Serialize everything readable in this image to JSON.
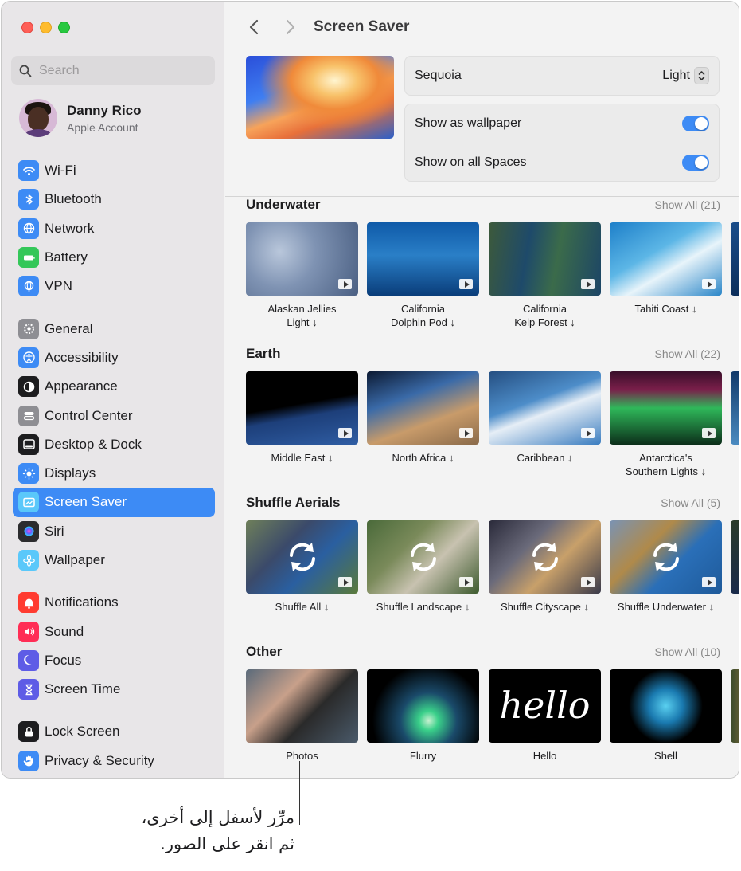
{
  "sidebar": {
    "search_placeholder": "Search",
    "account": {
      "name": "Danny Rico",
      "subtitle": "Apple Account"
    },
    "groups": [
      [
        {
          "label": "Wi-Fi",
          "icon": "wifi-icon",
          "color": "#3d8bf5"
        },
        {
          "label": "Bluetooth",
          "icon": "bluetooth-icon",
          "color": "#3d8bf5"
        },
        {
          "label": "Network",
          "icon": "globe-icon",
          "color": "#3d8bf5"
        },
        {
          "label": "Battery",
          "icon": "battery-icon",
          "color": "#34c759"
        },
        {
          "label": "VPN",
          "icon": "vpn-globe-icon",
          "color": "#3d8bf5"
        }
      ],
      [
        {
          "label": "General",
          "icon": "gear-icon",
          "color": "#8e8e93"
        },
        {
          "label": "Accessibility",
          "icon": "accessibility-icon",
          "color": "#3d8bf5"
        },
        {
          "label": "Appearance",
          "icon": "appearance-icon",
          "color": "#1d1d1f"
        },
        {
          "label": "Control Center",
          "icon": "control-center-icon",
          "color": "#8e8e93"
        },
        {
          "label": "Desktop & Dock",
          "icon": "dock-icon",
          "color": "#1d1d1f"
        },
        {
          "label": "Displays",
          "icon": "sun-icon",
          "color": "#3d8bf5"
        },
        {
          "label": "Screen Saver",
          "icon": "screen-saver-icon",
          "color": "#5ac8fa",
          "active": true
        },
        {
          "label": "Siri",
          "icon": "siri-icon",
          "color": "#2c2c2e"
        },
        {
          "label": "Wallpaper",
          "icon": "flower-icon",
          "color": "#5ac8fa"
        }
      ],
      [
        {
          "label": "Notifications",
          "icon": "bell-icon",
          "color": "#ff3b30"
        },
        {
          "label": "Sound",
          "icon": "speaker-icon",
          "color": "#ff2d55"
        },
        {
          "label": "Focus",
          "icon": "moon-icon",
          "color": "#5e5ce6"
        },
        {
          "label": "Screen Time",
          "icon": "hourglass-icon",
          "color": "#5e5ce6"
        }
      ],
      [
        {
          "label": "Lock Screen",
          "icon": "lock-icon",
          "color": "#1d1d1f"
        },
        {
          "label": "Privacy & Security",
          "icon": "hand-icon",
          "color": "#3d8bf5"
        }
      ]
    ]
  },
  "toolbar": {
    "title": "Screen Saver"
  },
  "current": {
    "name": "Sequoia",
    "variant": "Light",
    "show_as_wallpaper": {
      "label": "Show as wallpaper",
      "on": true
    },
    "show_on_all_spaces": {
      "label": "Show on all Spaces",
      "on": true
    }
  },
  "sections": [
    {
      "title": "Underwater",
      "show_all": "Show All (21)",
      "tiles": [
        {
          "label": "Alaskan Jellies\nLight ↓",
          "bg": "radial-gradient(circle at 30% 40%, #b9c7db 0%, #7f93b3 40%, #4a5f82 100%)",
          "type": "video"
        },
        {
          "label": "California\nDolphin Pod ↓",
          "bg": "linear-gradient(180deg, #0f5aa8 0%, #2a7fc7 45%, #0a3d7a 100%)",
          "type": "video"
        },
        {
          "label": "California\nKelp Forest ↓",
          "bg": "linear-gradient(100deg, #3d5a3a 0%, #1e4a6a 35%, #3b6b4a 60%, #1c4566 100%)",
          "type": "video"
        },
        {
          "label": "Tahiti Coast ↓",
          "bg": "linear-gradient(150deg, #1d7fc9 0%, #5cb6e6 40%, #e8f4fa 60%, #2b86c8 100%)",
          "type": "video"
        }
      ],
      "peek": "linear-gradient(180deg, #1a4d8a, #0d2f5c)"
    },
    {
      "title": "Earth",
      "show_all": "Show All (22)",
      "tiles": [
        {
          "label": "Middle East ↓",
          "bg": "linear-gradient(170deg, #000 0%, #000 45%, #1d3f7a 60%, #2f5da3 100%)",
          "type": "video"
        },
        {
          "label": "North Africa ↓",
          "bg": "linear-gradient(160deg, #0c1a33 0%, #3a6aa8 35%, #c89b6a 65%, #8a6a4a 100%)",
          "type": "video"
        },
        {
          "label": "Caribbean ↓",
          "bg": "linear-gradient(160deg, #254f82 0%, #4d8dc9 40%, #e6eef6 55%, #3b7dc0 100%)",
          "type": "video"
        },
        {
          "label": "Antarctica's\nSouthern Lights ↓",
          "bg": "linear-gradient(180deg, #3a0f2a 0%, #7a1f4a 25%, #2fb85a 50%, #0c2e1a 100%)",
          "type": "video"
        }
      ],
      "peek": "linear-gradient(180deg, #123a6a, #4a8ac0)"
    },
    {
      "title": "Shuffle Aerials",
      "show_all": "Show All (5)",
      "tiles": [
        {
          "label": "Shuffle All ↓",
          "bg": "linear-gradient(135deg, #6e7f5a 0%, #3b4a6a 35%, #2a5fa0 60%, #5a7a3a 100%)",
          "type": "shuffle"
        },
        {
          "label": "Shuffle Landscape ↓",
          "bg": "linear-gradient(135deg, #4a6a3a 0%, #7a8a5a 35%, #c8c2b0 60%, #3d5a2e 100%)",
          "type": "shuffle"
        },
        {
          "label": "Shuffle Cityscape ↓",
          "bg": "linear-gradient(135deg, #2a2a3a 0%, #6a6a7a 35%, #c8a06a 60%, #3a3a4a 100%)",
          "type": "shuffle"
        },
        {
          "label": "Shuffle Underwater ↓",
          "bg": "linear-gradient(135deg, #7a93b3 0%, #b08a4a 35%, #2a6fb8 60%, #1e5a9a 100%)",
          "type": "shuffle"
        }
      ],
      "peek": "linear-gradient(180deg, #2a3a2a, #1a2a4a)"
    },
    {
      "title": "Other",
      "show_all": "Show All (10)",
      "tiles": [
        {
          "label": "Photos",
          "bg": "linear-gradient(135deg, #5a6a7a 0%, #c8a08a 35%, #2a2a2a 60%, #4a5a6a 100%)",
          "type": "static"
        },
        {
          "label": "Flurry",
          "bg": "radial-gradient(circle at 55% 70%, #c8f0d0 0%, #3ad08a 12%, #1a4a6a 35%, #000 70%)",
          "type": "static"
        },
        {
          "label": "Hello",
          "bg": "#000000",
          "type": "hello",
          "word": "hello"
        },
        {
          "label": "Shell",
          "bg": "radial-gradient(circle at 50% 50%, #5ad0f0 0%, #1a7ab0 25%, #000 55%)",
          "type": "static"
        }
      ],
      "peek": "linear-gradient(90deg, #3a4a2a, #7a6a3a)"
    }
  ],
  "callout": {
    "line1": "مرِّر لأسفل إلى أخرى،",
    "line2": "ثم انقر على الصور."
  }
}
